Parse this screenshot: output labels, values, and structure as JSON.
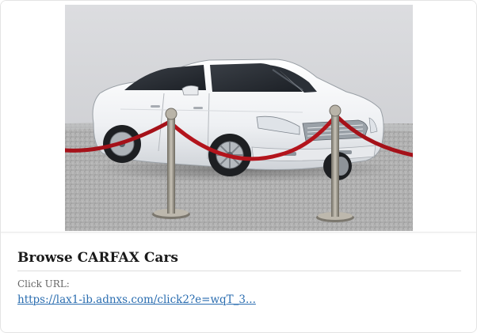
{
  "ad": {
    "title": "Browse CARFAX Cars",
    "click_label": "Click URL:",
    "click_url": "https://lax1-ib.adnxs.com/click2?e=wqT_3...",
    "image_alt": "White sedan displayed between red velvet rope stanchions"
  },
  "colors": {
    "link": "#2a6db0",
    "title": "#1a1a1a",
    "car_body": "#f2f3f5",
    "rope": "#b3141c"
  }
}
